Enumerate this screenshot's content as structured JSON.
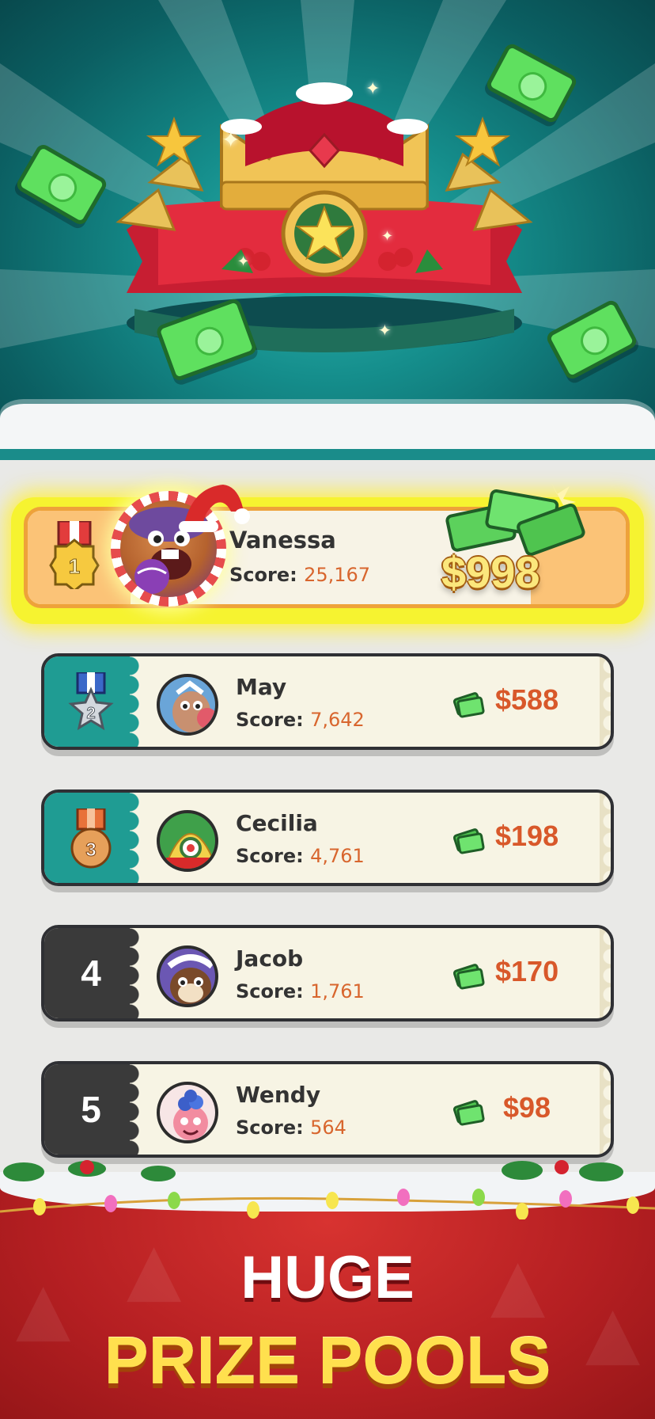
{
  "footer": {
    "line1": "HUGE",
    "line2": "PRIZE POOLS"
  },
  "leaderboard": [
    {
      "rank": "1",
      "name": "Vanessa",
      "score_label": "Score:",
      "score": "25,167",
      "prize": "$998",
      "medal": "gold-medal-icon"
    },
    {
      "rank": "2",
      "name": "May",
      "score_label": "Score:",
      "score": "7,642",
      "prize": "$588",
      "medal": "silver-medal-icon"
    },
    {
      "rank": "3",
      "name": "Cecilia",
      "score_label": "Score:",
      "score": "4,761",
      "prize": "$198",
      "medal": "bronze-medal-icon"
    },
    {
      "rank": "4",
      "name": "Jacob",
      "score_label": "Score:",
      "score": "1,761",
      "prize": "$170"
    },
    {
      "rank": "5",
      "name": "Wendy",
      "score_label": "Score:",
      "score": "564",
      "prize": "$98"
    }
  ],
  "colors": {
    "hero_teal": "#158e8c",
    "prize_orange": "#d8582a",
    "row_teal": "#1f9c93",
    "row_dark": "#3a3a3a",
    "gold_glow": "#f6f330",
    "footer_red": "#b51f22",
    "title_yellow": "#ffe04e"
  }
}
